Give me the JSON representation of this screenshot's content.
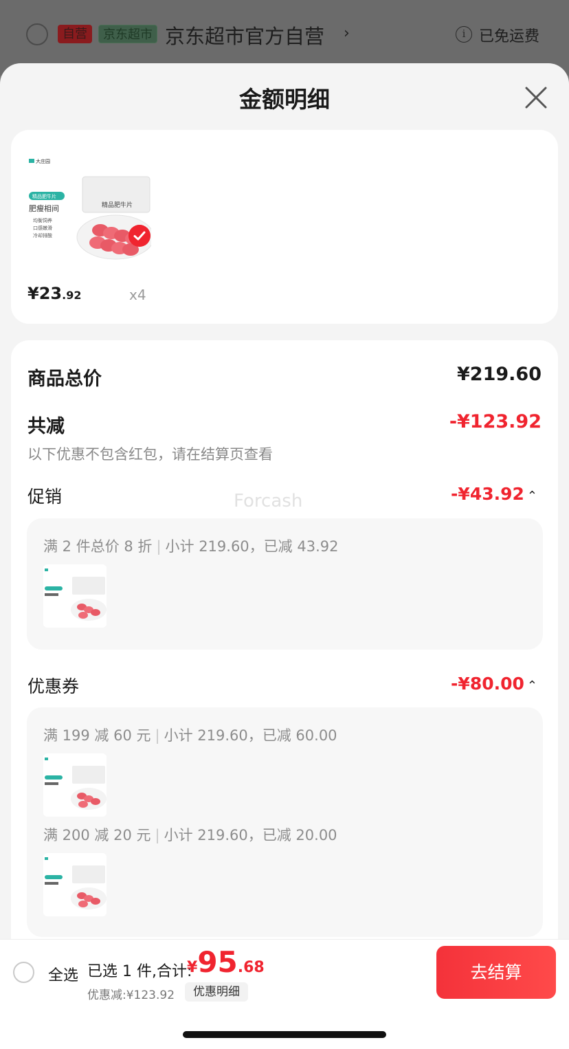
{
  "store": {
    "self_tag": "自营",
    "market_tag": "京东超市",
    "name": "京东超市官方自营",
    "chevron": "›",
    "info_glyph": "i",
    "shipping": "已免运费"
  },
  "sheet": {
    "title": "金额明细",
    "close_icon": "close-icon"
  },
  "product": {
    "price_symbol": "¥",
    "price_int": "23",
    "price_dec": ".92",
    "qty": "x4",
    "thumb_texts": {
      "brand": "大庄园",
      "badge": "精品肥牛片",
      "headline": "肥瘦相间",
      "features": [
        "均衡饲养",
        "口感嫩滑",
        "冷却排酸"
      ],
      "pack_label": "精品肥牛片"
    }
  },
  "details": {
    "total_label": "商品总价",
    "total_value": "¥219.60",
    "reduce_label": "共减",
    "reduce_value": "-¥123.92",
    "hint": "以下优惠不包含红包，请在结算页查看",
    "promo_label": "促销",
    "promo_value": "-¥43.92",
    "promo_rule_a": "满 2 件总价 8 折",
    "promo_rule_b": "小计 219.60，已减 43.92",
    "coupon_label": "优惠券",
    "coupon_value": "-¥80.00",
    "coupon_rules": [
      {
        "a": "满 199 减 60 元",
        "b": "小计 219.60，已减 60.00"
      },
      {
        "a": "满 200 减 20 元",
        "b": "小计 219.60，已减 20.00"
      }
    ],
    "chevron_up": "⌃",
    "separator": "|"
  },
  "watermark": "Forcash",
  "checkout": {
    "select_all": "全选",
    "summary": "已选 1 件,合计:",
    "total_symbol": "¥",
    "total_int": "95",
    "total_dec": ".68",
    "discount": "优惠减:¥123.92",
    "detail_link": "优惠明细",
    "button": "去结算"
  },
  "colors": {
    "accent": "#f0242f",
    "teal": "#2bb3a4"
  }
}
